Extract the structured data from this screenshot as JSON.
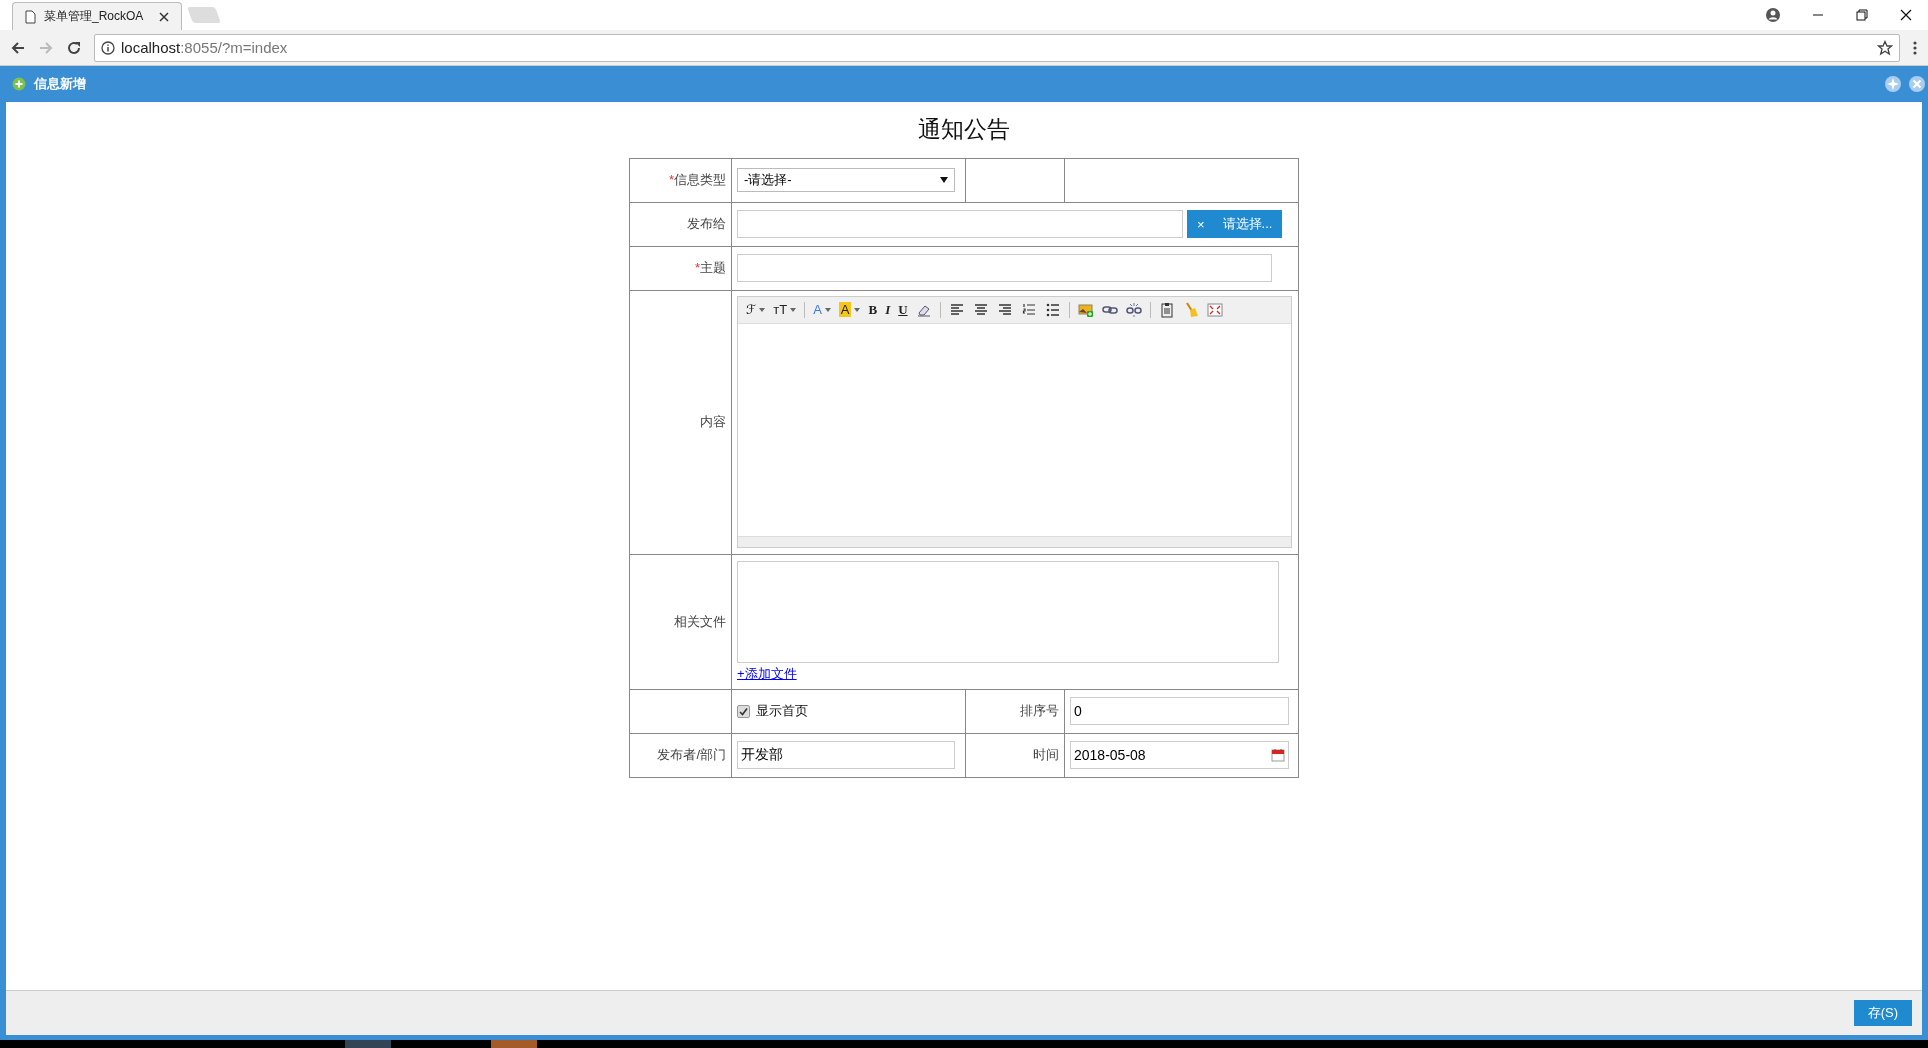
{
  "browser": {
    "tab_title": "菜单管理_RockOA",
    "url_host": "localhost",
    "url_rest": ":8055/?m=index"
  },
  "dialog": {
    "title": "信息新增"
  },
  "form": {
    "title": "通知公告",
    "type": {
      "label": "信息类型",
      "required": "*",
      "value": "-请选择-"
    },
    "recipients": {
      "label": "发布给",
      "clear": "×",
      "choose": "请选择..."
    },
    "subject": {
      "label": "主题",
      "required": "*"
    },
    "content": {
      "label": "内容",
      "toolbar": [
        {
          "kind": "menu",
          "glyph": "ℱ"
        },
        {
          "kind": "menu",
          "glyph": "тT"
        },
        {
          "kind": "sep"
        },
        {
          "kind": "font-color",
          "glyph": "A"
        },
        {
          "kind": "highlight",
          "glyph": "A"
        },
        {
          "kind": "bold",
          "glyph": "B"
        },
        {
          "kind": "italic",
          "glyph": "I"
        },
        {
          "kind": "underline",
          "glyph": "U"
        },
        {
          "kind": "eraser"
        },
        {
          "kind": "sep"
        },
        {
          "kind": "align-left"
        },
        {
          "kind": "align-center"
        },
        {
          "kind": "align-right"
        },
        {
          "kind": "ordered-list"
        },
        {
          "kind": "bullet-list"
        },
        {
          "kind": "sep"
        },
        {
          "kind": "image"
        },
        {
          "kind": "link"
        },
        {
          "kind": "unlink"
        },
        {
          "kind": "sep"
        },
        {
          "kind": "paste"
        },
        {
          "kind": "broom"
        },
        {
          "kind": "fullscreen"
        }
      ]
    },
    "files": {
      "label": "相关文件",
      "add_link": "+添加文件"
    },
    "show_home": {
      "label": "显示首页",
      "checked": true
    },
    "order": {
      "label": "排序号",
      "value": "0"
    },
    "publisher": {
      "label": "发布者/部门",
      "value": "开发部"
    },
    "time": {
      "label": "时间",
      "value": "2018-05-08"
    }
  },
  "footer": {
    "save": "存(S)"
  }
}
